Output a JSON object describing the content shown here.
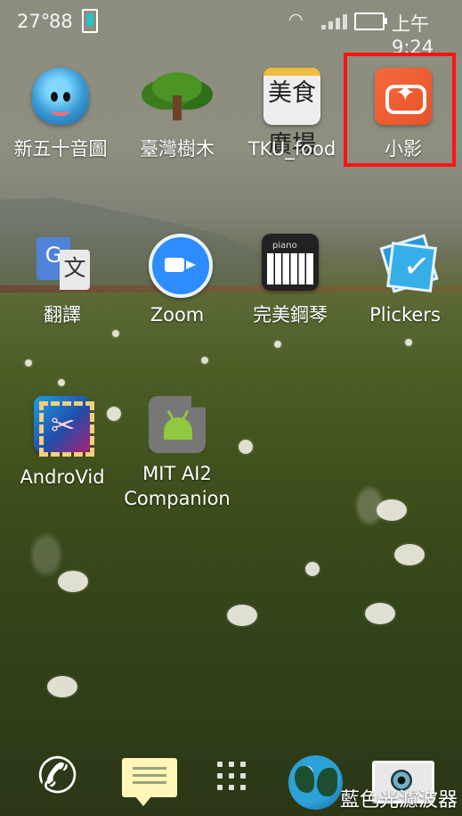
{
  "status_bar": {
    "temperature": "27°",
    "battery_percent": "88",
    "time": "上午9:24"
  },
  "apps": [
    {
      "label": "新五十音圖",
      "icon": "slime-icon"
    },
    {
      "label": "臺灣樹木",
      "icon": "tree-icon"
    },
    {
      "label": "TKU_food",
      "icon": "food-court-icon",
      "icon_text": "美食廣場"
    },
    {
      "label": "小影",
      "icon": "video-star-icon"
    },
    {
      "label": "翻譯",
      "icon": "translate-icon",
      "icon_text": "G",
      "icon_text_2": "文"
    },
    {
      "label": "Zoom",
      "icon": "zoom-camera-icon"
    },
    {
      "label": "完美鋼琴",
      "icon": "piano-icon",
      "icon_text": "piano"
    },
    {
      "label": "Plickers",
      "icon": "plickers-check-icon"
    },
    {
      "label": "AndroVid",
      "icon": "video-edit-icon"
    },
    {
      "label_line_1": "MIT AI2",
      "label_line_2": "Companion",
      "icon": "android-puzzle-icon"
    }
  ],
  "dock": {
    "phone_icon": "phone-icon",
    "messages_icon": "message-icon",
    "apps_icon": "app-drawer-icon",
    "browser_icon": "globe-icon",
    "camera_icon": "camera-icon",
    "overlay_text": "藍色光濾波器"
  },
  "colors": {
    "highlight": "#ff1313",
    "xiao_ying": "#f26a3d",
    "zoom": "#2d8cff"
  }
}
